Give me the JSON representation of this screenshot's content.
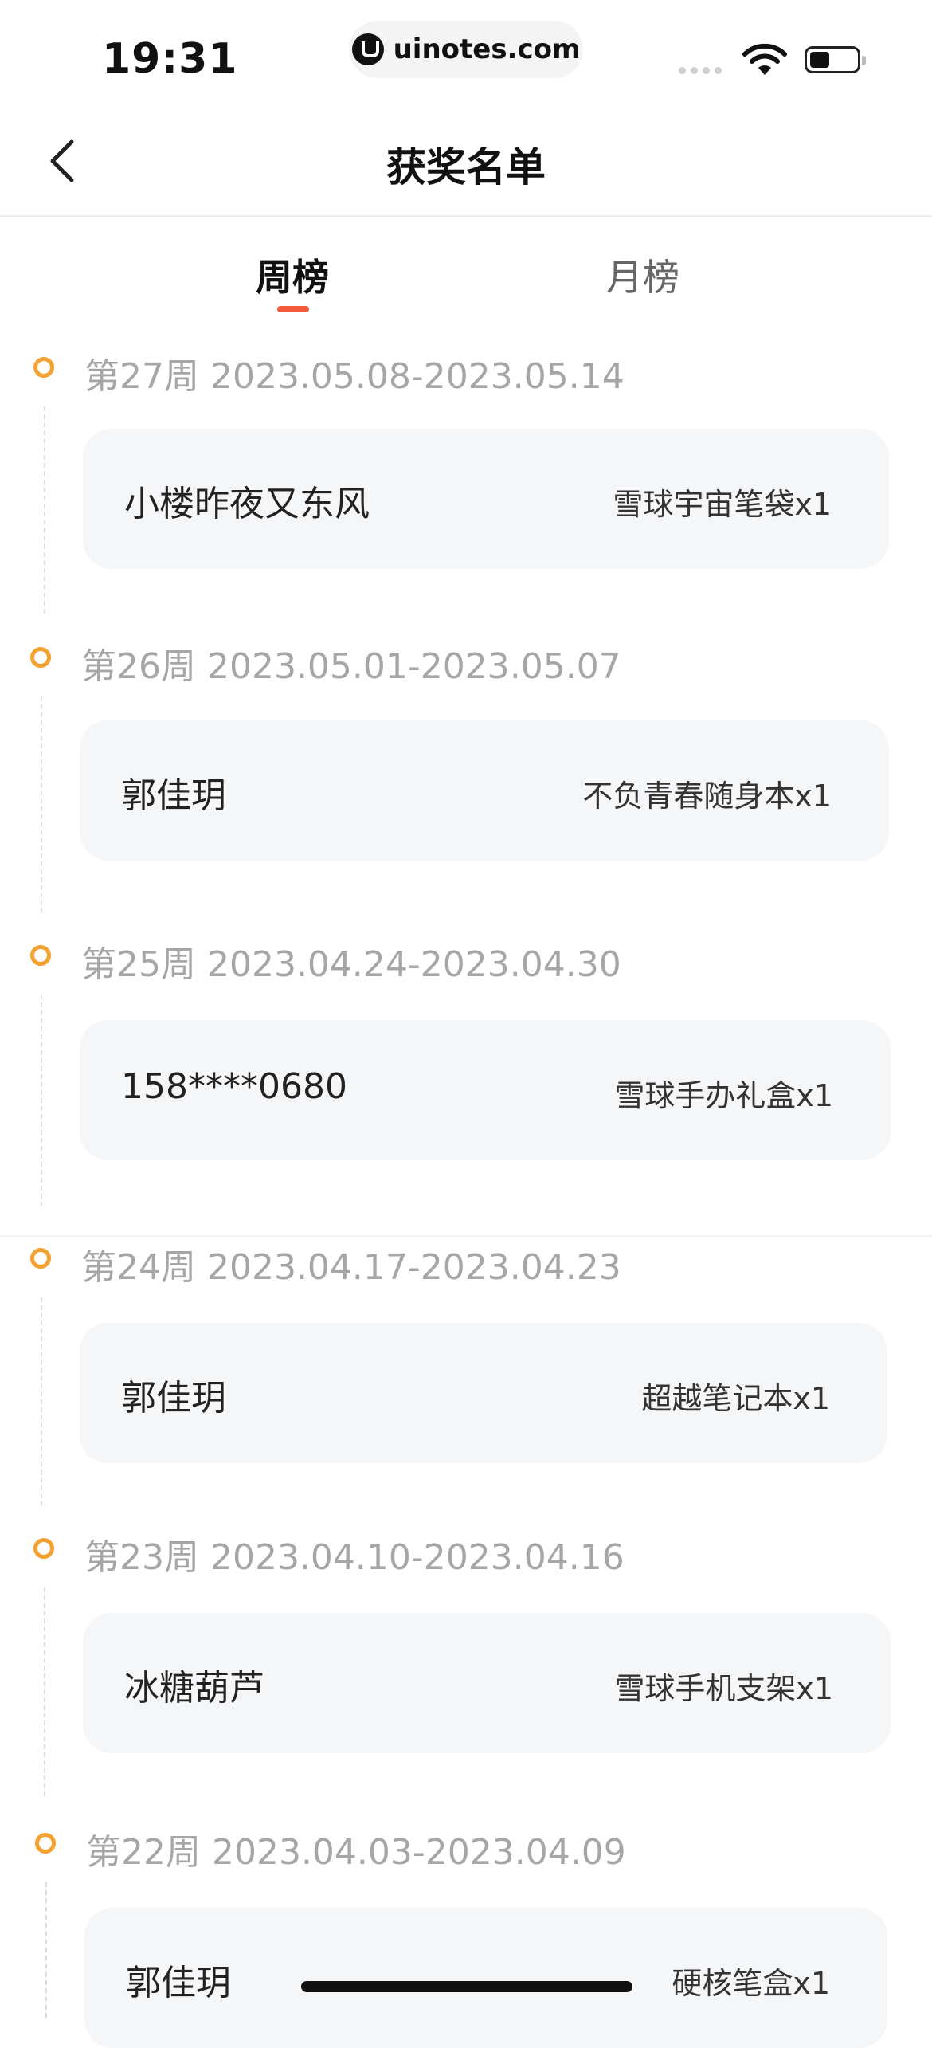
{
  "status_bar": {
    "time": "19:31",
    "url": "uinotes.com"
  },
  "nav": {
    "title": "获奖名单"
  },
  "tabs": [
    {
      "label": "周榜",
      "active": true
    },
    {
      "label": "月榜",
      "active": false
    }
  ],
  "colors": {
    "accent": "#f05a3a",
    "timeline_dot": "#f3a131",
    "card_bg": "#f5f6f8",
    "period_text": "#a6a6a6"
  },
  "winners": [
    {
      "period": "第27周 2023.05.08-2023.05.14",
      "name": "小楼昨夜又东风",
      "prize": "雪球宇宙笔袋x1"
    },
    {
      "period": "第26周 2023.05.01-2023.05.07",
      "name": "郭佳玥",
      "prize": "不负青春随身本x1"
    },
    {
      "period": "第25周 2023.04.24-2023.04.30",
      "name": "158****0680",
      "prize": "雪球手办礼盒x1"
    },
    {
      "period": "第24周 2023.04.17-2023.04.23",
      "name": "郭佳玥",
      "prize": "超越笔记本x1"
    },
    {
      "period": "第23周 2023.04.10-2023.04.16",
      "name": "冰糖葫芦",
      "prize": "雪球手机支架x1"
    },
    {
      "period": "第22周 2023.04.03-2023.04.09",
      "name": "郭佳玥",
      "prize": "硬核笔盒x1"
    }
  ]
}
